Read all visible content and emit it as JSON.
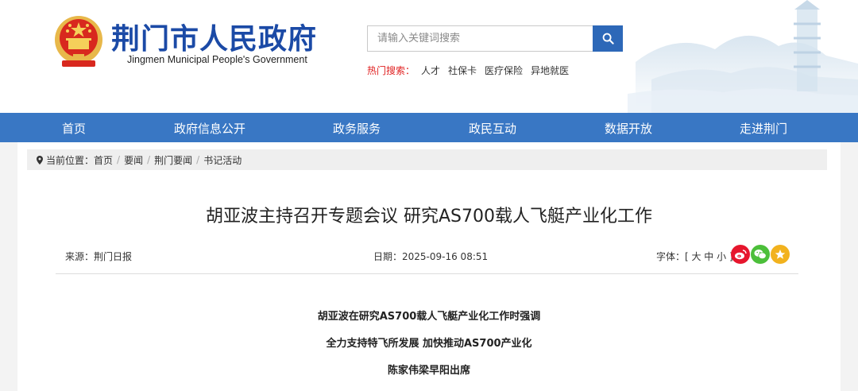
{
  "header": {
    "site_name_cn": "荆门市人民政府",
    "site_name_en": "Jingmen Municipal People's Government"
  },
  "search": {
    "placeholder": "请输入关键词搜索",
    "hot_label": "热门搜索：",
    "hot_items": [
      "人才",
      "社保卡",
      "医疗保险",
      "异地就医"
    ]
  },
  "nav": {
    "items": [
      "首页",
      "政府信息公开",
      "政务服务",
      "政民互动",
      "数据开放",
      "走进荆门"
    ]
  },
  "breadcrumb": {
    "prefix": "当前位置：",
    "items": [
      "首页",
      "要闻",
      "荆门要闻",
      "书记活动"
    ]
  },
  "article": {
    "title": "胡亚波主持召开专题会议 研究AS700载人飞艇产业化工作",
    "source": "来源：荆门日报",
    "date": "日期：2025-09-16 08:51",
    "font_size": "字体：[ 大 中 小 ]",
    "subtitles": [
      "胡亚波在研究AS700载人飞艇产业化工作时强调",
      "全力支持特飞所发展 加快推动AS700产业化",
      "陈家伟梁早阳出席"
    ]
  },
  "colors": {
    "nav_bg": "#3977c4",
    "logo_blue": "#1b4aa6",
    "hot_red": "#e02020",
    "weibo": "#e6162d",
    "wechat": "#4cbf3a",
    "favorite": "#f2b21e"
  }
}
